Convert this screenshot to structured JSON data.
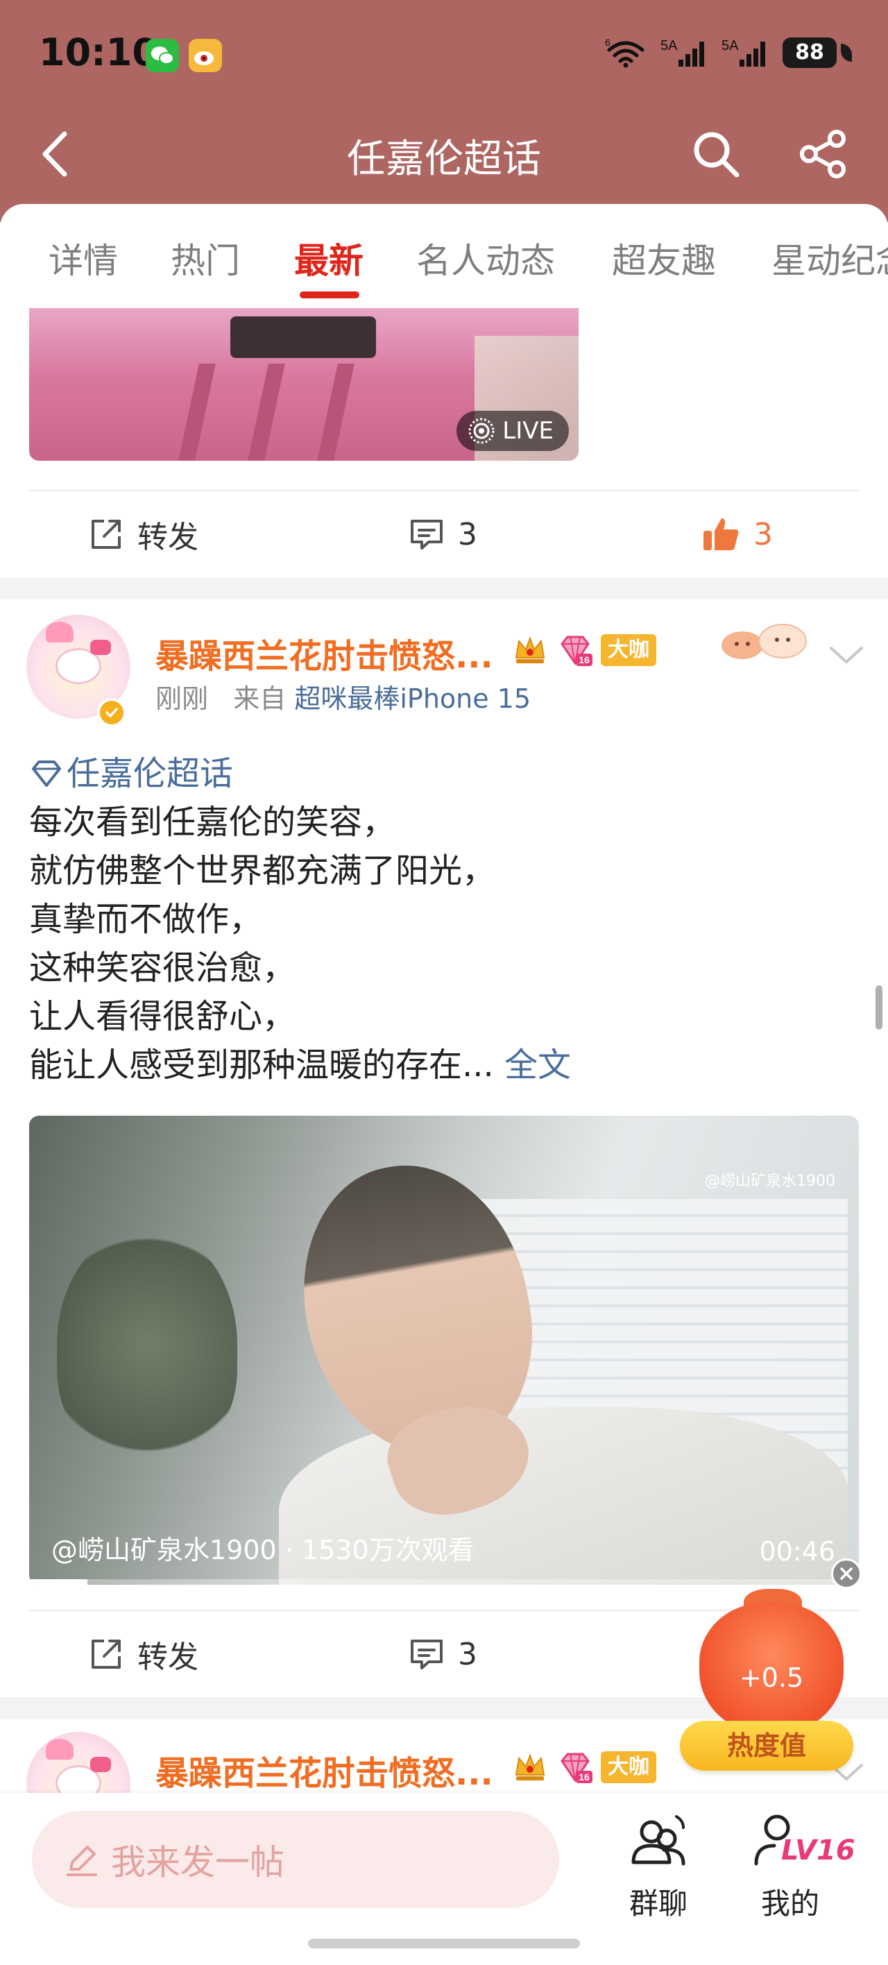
{
  "status_bar": {
    "time": "10:10",
    "network_1": "5A",
    "network_2": "5A",
    "wifi_gen": "6",
    "battery": "88"
  },
  "nav": {
    "title": "任嘉伦超话"
  },
  "tabs": [
    {
      "label": "详情"
    },
    {
      "label": "热门"
    },
    {
      "label": "最新"
    },
    {
      "label": "名人动态"
    },
    {
      "label": "超友趣"
    },
    {
      "label": "星动纪念"
    }
  ],
  "active_tab": "最新",
  "post1": {
    "live_label": "LIVE",
    "repost_label": "转发",
    "comment_count": "3",
    "like_count": "3"
  },
  "post2": {
    "username": "暴躁西兰花肘击愤怒...",
    "badge_label": "大咖",
    "gem_level": "16",
    "time": "刚刚",
    "from_label": "来自",
    "device": "超咪最棒iPhone 15",
    "topic": "任嘉伦超话",
    "lines": [
      "每次看到任嘉伦的笑容，",
      "就仿佛整个世界都充满了阳光，",
      "真挚而不做作，",
      "这种笑容很治愈，",
      "让人看得很舒心，",
      "能让人感受到那种温暖的存在..."
    ],
    "full_text_label": "全文",
    "video": {
      "watermark": "@崂山矿泉水1900",
      "info": "@崂山矿泉水1900 · 1530万次观看",
      "duration": "00:46",
      "progress": 0.07
    },
    "repost_label": "转发",
    "comment_count": "3"
  },
  "post3": {
    "username": "暴躁西兰花肘击愤怒...",
    "badge_label": "大咖",
    "gem_level": "16"
  },
  "heat_widget": {
    "value": "+0.5",
    "label": "热度值"
  },
  "bottom_bar": {
    "compose_placeholder": "我来发一帖",
    "group_chat_label": "群聊",
    "mine_label": "我的",
    "level": "LV16"
  },
  "colors": {
    "header_bg": "#ad6661",
    "accent_red": "#e0251b",
    "username_orange": "#f06d22",
    "link_blue": "#4a6d9a",
    "like_orange": "#f0773d"
  }
}
